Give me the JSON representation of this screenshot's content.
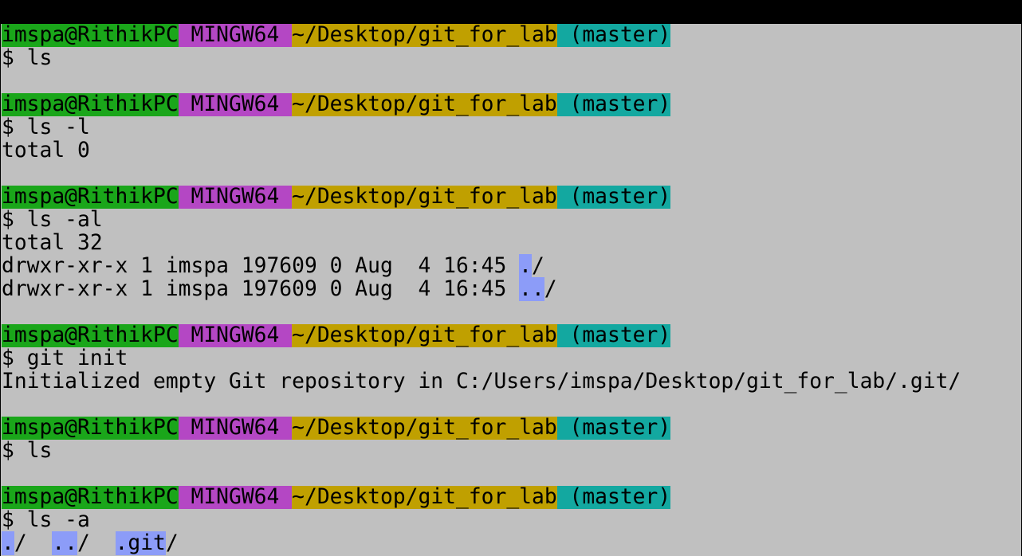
{
  "colors": {
    "background": "#c0c0c0",
    "prompt_user_bg": "#1aa61a",
    "prompt_system_bg": "#b447c4",
    "prompt_path_bg": "#c0a000",
    "prompt_branch_bg": "#13a8a0",
    "directory_highlight": "#8c9cf8"
  },
  "prompt": {
    "user_host": "imspa@RithikPC",
    "system": "MINGW64",
    "path": "~/Desktop/git_for_lab",
    "branch": "(master)",
    "symbol": "$"
  },
  "blocks": [
    {
      "command": "ls",
      "output": []
    },
    {
      "command": "ls -l",
      "output": [
        "total 0"
      ]
    },
    {
      "command": "ls -al",
      "output": [
        "total 32"
      ],
      "entries": [
        {
          "meta": "drwxr-xr-x 1 imspa 197609 0 Aug  4 16:45 ",
          "name": ".",
          "suffix": "/"
        },
        {
          "meta": "drwxr-xr-x 1 imspa 197609 0 Aug  4 16:45 ",
          "name": "..",
          "suffix": "/"
        }
      ]
    },
    {
      "command": "git init",
      "output": [
        "Initialized empty Git repository in C:/Users/imspa/Desktop/git_for_lab/.git/"
      ]
    },
    {
      "command": "ls",
      "output": []
    },
    {
      "command": "ls -a",
      "dirs": [
        {
          "name": ".",
          "suffix": "/"
        },
        {
          "name": "..",
          "suffix": "/"
        },
        {
          "name": ".git",
          "suffix": "/"
        }
      ]
    }
  ]
}
